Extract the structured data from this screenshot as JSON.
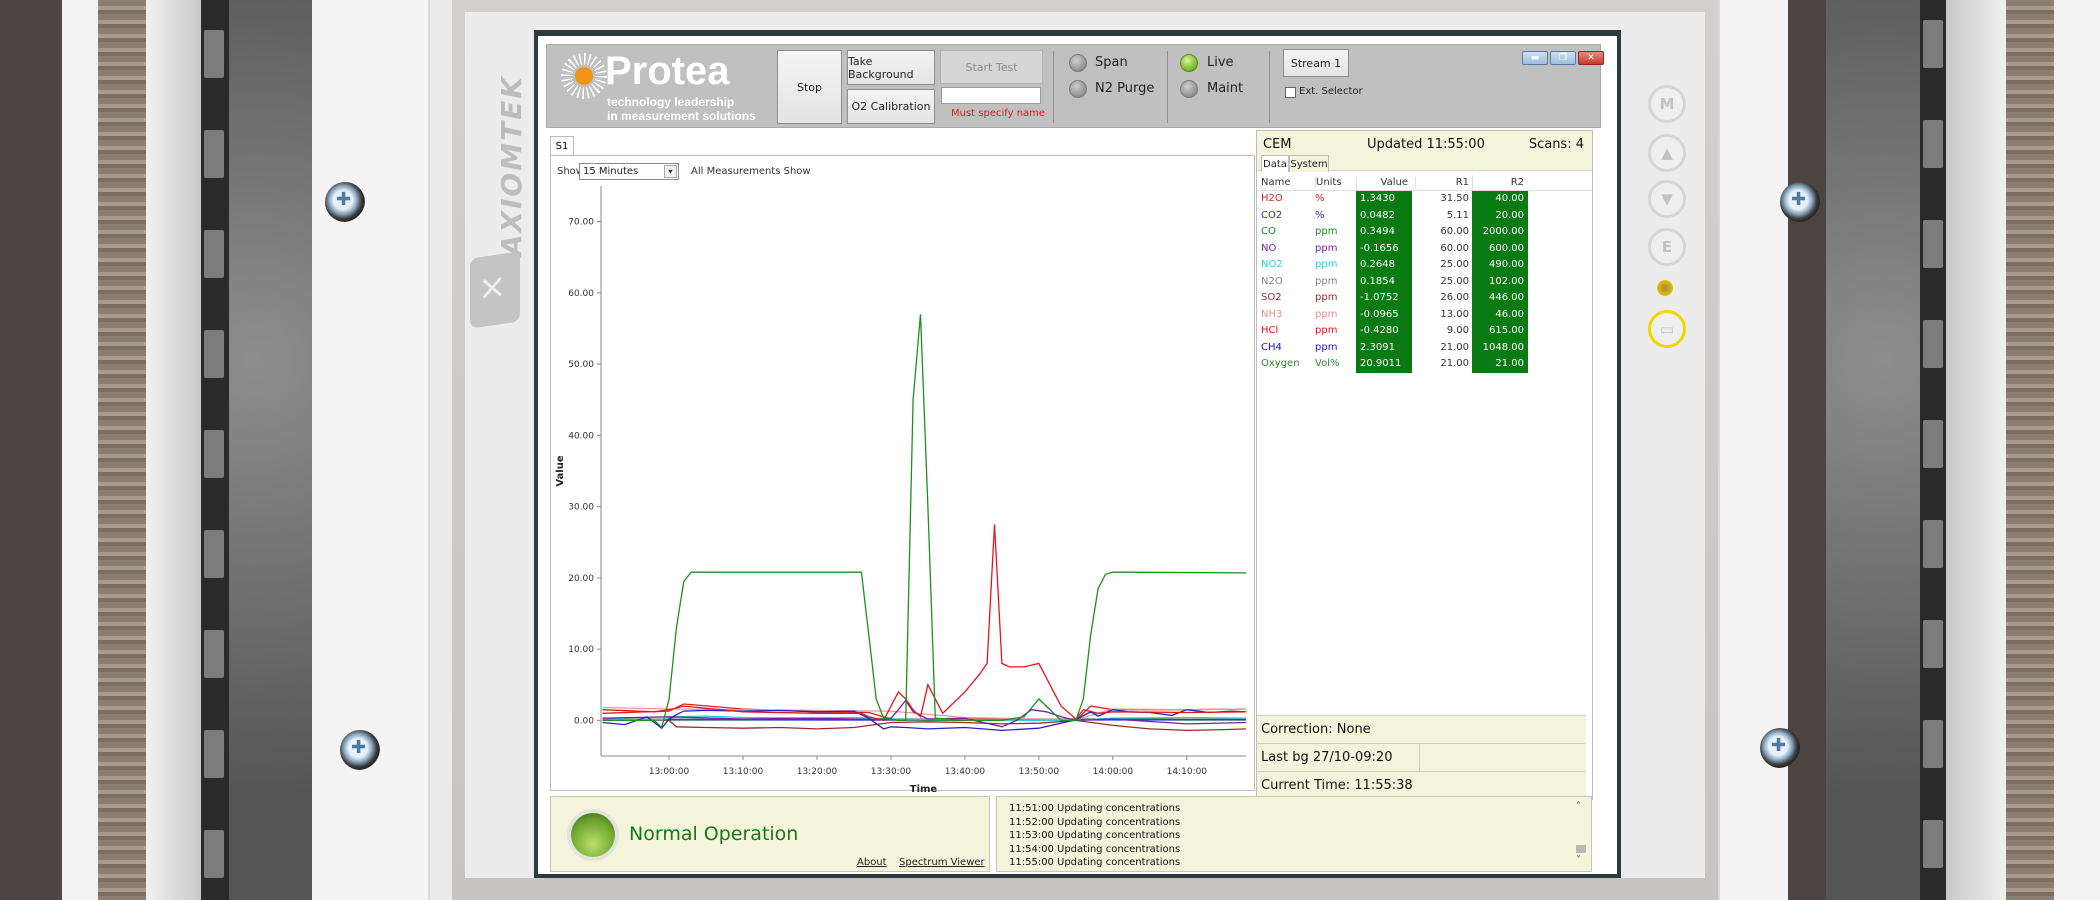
{
  "hardware": {
    "brand": "AXIOMTEK",
    "side_buttons": [
      {
        "name": "menu",
        "glyph": "M"
      },
      {
        "name": "up",
        "glyph": "▲"
      },
      {
        "name": "down",
        "glyph": "▼"
      },
      {
        "name": "enter",
        "glyph": "E"
      },
      {
        "name": "power-led",
        "glyph": ""
      },
      {
        "name": "screen",
        "glyph": "▭"
      }
    ]
  },
  "app": {
    "logo": {
      "name": "Protea",
      "tagline_1": "technology leadership",
      "tagline_2": "in measurement solutions",
      "sun_color": "#f39419"
    },
    "toolbar": {
      "stop": "Stop",
      "take_background": "Take Background",
      "start_test": "Start Test",
      "o2_calibration": "O2 Calibration",
      "test_name_value": "",
      "test_name_warning": "Must specify name",
      "modes": [
        {
          "label": "Span",
          "active": false
        },
        {
          "label": "N2 Purge",
          "active": false
        },
        {
          "label": "Live",
          "active": true
        },
        {
          "label": "Maint",
          "active": false
        }
      ],
      "stream_button": "Stream 1",
      "ext_selector_label": "Ext. Selector",
      "ext_selector_checked": false
    },
    "window_controls": {
      "minimize": "▬",
      "restore": "❐",
      "close": "✕"
    },
    "chart_panel": {
      "tab": "S1",
      "show_label": "Show",
      "show_value": "15 Minutes",
      "all_measurements": "All Measurements Show"
    },
    "cem": {
      "title": "CEM",
      "updated": "Updated 11:55:00",
      "scans": "Scans: 4",
      "tabs": [
        "Data",
        "System"
      ],
      "columns": [
        "Name",
        "Units",
        "Value",
        "R1",
        "R2"
      ],
      "rows": [
        {
          "name": "H2O",
          "units": "%",
          "value": "1.3430",
          "r1": "31.50",
          "r2": "40.00",
          "color": "#d9241c"
        },
        {
          "name": "CO2",
          "units": "%",
          "value": "0.0482",
          "r1": "5.11",
          "r2": "20.00",
          "color": "#2a2ab8"
        },
        {
          "name": "CO",
          "units": "ppm",
          "value": "0.3494",
          "r1": "60.00",
          "r2": "2000.00",
          "color": "#1d8a1d"
        },
        {
          "name": "NO",
          "units": "ppm",
          "value": "-0.1656",
          "r1": "60.00",
          "r2": "600.00",
          "color": "#7a1fa2"
        },
        {
          "name": "NO2",
          "units": "ppm",
          "value": "0.2648",
          "r1": "25.00",
          "r2": "490.00",
          "color": "#22d4dc"
        },
        {
          "name": "N2O",
          "units": "ppm",
          "value": "0.1854",
          "r1": "25.00",
          "r2": "102.00",
          "color": "#808080"
        },
        {
          "name": "SO2",
          "units": "ppm",
          "value": "-1.0752",
          "r1": "26.00",
          "r2": "446.00",
          "color": "#a02a2a"
        },
        {
          "name": "NH3",
          "units": "ppm",
          "value": "-0.0965",
          "r1": "13.00",
          "r2": "46.00",
          "color": "#e8908a"
        },
        {
          "name": "HCl",
          "units": "ppm",
          "value": "-0.4280",
          "r1": "9.00",
          "r2": "615.00",
          "color": "#e0141e"
        },
        {
          "name": "CH4",
          "units": "ppm",
          "value": "2.3091",
          "r1": "21.00",
          "r2": "1048.00",
          "color": "#1a1ad0"
        },
        {
          "name": "Oxygen",
          "units": "Vol%",
          "value": "20.9011",
          "r1": "21.00",
          "r2": "21.00",
          "color": "#2a8a2a"
        }
      ],
      "correction": "Correction: None",
      "last_bg": "Last bg 27/10-09:20",
      "current_time": "Current Time: 11:55:38"
    },
    "status": {
      "text": "Normal Operation",
      "color": "#6ea431",
      "links": [
        "About",
        "Spectrum Viewer"
      ]
    },
    "log": [
      {
        "time": "11:51:00",
        "msg": "Updating concentrations"
      },
      {
        "time": "11:52:00",
        "msg": "Updating concentrations"
      },
      {
        "time": "11:53:00",
        "msg": "Updating concentrations"
      },
      {
        "time": "11:54:00",
        "msg": "Updating concentrations"
      },
      {
        "time": "11:55:00",
        "msg": "Updating concentrations"
      }
    ]
  },
  "chart_data": {
    "type": "line",
    "title": "",
    "xlabel": "Time",
    "ylabel": "Value",
    "x_unit": "minutes after 13:00:00",
    "xlim": [
      -9.2,
      78
    ],
    "ylim": [
      -5,
      75
    ],
    "xticks": [
      0,
      10,
      20,
      30,
      40,
      50,
      60,
      70
    ],
    "xtick_labels": [
      "13:00:00",
      "13:10:00",
      "13:20:00",
      "13:30:00",
      "13:40:00",
      "13:50:00",
      "14:00:00",
      "14:10:00"
    ],
    "yticks": [
      0,
      10,
      20,
      30,
      40,
      50,
      60,
      70
    ],
    "ytick_labels": [
      "0.00",
      "10.00",
      "20.00",
      "30.00",
      "40.00",
      "50.00",
      "60.00",
      "70.00"
    ],
    "grid": false,
    "legend": "none",
    "series": [
      {
        "name": "Oxygen",
        "color": "#1f8f1f",
        "x": [
          -9,
          -2,
          -1,
          0,
          1,
          2,
          3,
          26,
          27,
          28,
          29,
          31,
          32,
          33,
          34,
          35,
          36,
          40,
          45,
          48,
          50,
          53,
          55,
          56,
          57,
          58,
          59,
          60,
          62,
          78
        ],
        "y": [
          0,
          0,
          -1,
          3,
          13,
          19.5,
          20.8,
          20.8,
          12,
          3,
          0.3,
          0,
          0,
          45,
          57,
          30,
          0.3,
          0,
          0,
          0.5,
          3,
          0,
          0,
          3,
          12,
          18.5,
          20.5,
          20.8,
          20.8,
          20.7
        ]
      },
      {
        "name": "HCl",
        "color": "#e8141c",
        "x": [
          -9,
          -2,
          0,
          2,
          10,
          20,
          26,
          27,
          29,
          30,
          31,
          32,
          33,
          34,
          35,
          37,
          40,
          42,
          43,
          44,
          45,
          46,
          48,
          50,
          52,
          53,
          55,
          56,
          58,
          60,
          70,
          78
        ],
        "y": [
          1.5,
          1.2,
          1.5,
          2,
          1.2,
          1.0,
          1.0,
          0.5,
          0,
          2,
          4,
          3,
          1.5,
          0.5,
          5,
          1,
          4,
          6.5,
          8,
          27.5,
          8,
          7.5,
          7.5,
          8,
          4,
          2,
          0.2,
          1.5,
          1.0,
          1.2,
          1.1,
          1.2
        ]
      },
      {
        "name": "CH4",
        "color": "#2222d0",
        "x": [
          -9,
          -6,
          -3,
          -1,
          0,
          1,
          2,
          5,
          10,
          15,
          20,
          25,
          27,
          29,
          30,
          32,
          35,
          40,
          45,
          50,
          55,
          57,
          58,
          60,
          62,
          65,
          68,
          70,
          73,
          76,
          78
        ],
        "y": [
          -0.3,
          -0.6,
          0.5,
          -1.1,
          0.2,
          0.8,
          1.3,
          1.4,
          1.3,
          1.4,
          1.2,
          1.3,
          0.3,
          -1.2,
          -0.9,
          -1.0,
          -1.2,
          -1.0,
          -1.4,
          -1.1,
          0.1,
          1.2,
          0.6,
          1.5,
          1.2,
          1.1,
          0.7,
          1.5,
          1.1,
          1.3,
          1.2
        ]
      },
      {
        "name": "NO",
        "color": "#7a1fa2",
        "x": [
          -9,
          0,
          10,
          20,
          28,
          30,
          31,
          32,
          33,
          35,
          40,
          45,
          47,
          49,
          51,
          53,
          55,
          60,
          70,
          78
        ],
        "y": [
          0.3,
          0.5,
          0.2,
          0.3,
          0.1,
          0.3,
          1.5,
          2.8,
          1.2,
          0.2,
          0.3,
          -0.9,
          0,
          1.5,
          1.2,
          0.5,
          0,
          0.2,
          -0.5,
          -0.3
        ]
      },
      {
        "name": "NO2",
        "color": "#22d0d8",
        "x": [
          -9,
          -1,
          1,
          5,
          10,
          20,
          25,
          30,
          40,
          50,
          55,
          60,
          70,
          78
        ],
        "y": [
          0.2,
          0.1,
          0.5,
          0.6,
          0.4,
          0.3,
          0.4,
          0.2,
          0.1,
          0.0,
          0.0,
          0.3,
          0.4,
          0.3
        ]
      },
      {
        "name": "SO2",
        "color": "#a02a2a",
        "x": [
          -9,
          0,
          1,
          5,
          10,
          15,
          20,
          25,
          30,
          35,
          40,
          45,
          50,
          55,
          60,
          65,
          70,
          75,
          78
        ],
        "y": [
          0.2,
          0.0,
          -0.9,
          -1.0,
          -1.1,
          -1.0,
          -1.2,
          -1.0,
          -0.3,
          -0.2,
          -0.3,
          -0.5,
          -0.4,
          0.0,
          -0.7,
          -1.2,
          -1.4,
          -1.3,
          -1.2
        ]
      },
      {
        "name": "NH3",
        "color": "#eb9a94",
        "x": [
          -9,
          0,
          10,
          20,
          30,
          40,
          50,
          55,
          60,
          70,
          78
        ],
        "y": [
          1.8,
          1.6,
          1.5,
          1.4,
          1.3,
          0.4,
          0.2,
          0.1,
          1.6,
          1.5,
          1.6
        ]
      },
      {
        "name": "H2O",
        "color": "#d9241c",
        "x": [
          -9,
          0,
          2,
          10,
          20,
          27,
          30,
          40,
          50,
          55,
          57,
          60,
          70,
          78
        ],
        "y": [
          1.0,
          1.3,
          2.3,
          1.6,
          1.2,
          1.1,
          0.2,
          0.2,
          0.1,
          0.0,
          2.0,
          1.5,
          1.5,
          1.6
        ]
      },
      {
        "name": "CO",
        "color": "#0f6f0f",
        "x": [
          -9,
          10,
          20,
          30,
          40,
          50,
          60,
          70,
          78
        ],
        "y": [
          0.1,
          0.1,
          0.2,
          0.1,
          0.0,
          0.1,
          0.2,
          0.1,
          0.1
        ]
      },
      {
        "name": "CO2",
        "color": "#3a3ac8",
        "x": [
          -9,
          10,
          30,
          50,
          78
        ],
        "y": [
          0.05,
          0.05,
          0.04,
          0.05,
          0.05
        ]
      },
      {
        "name": "N2O",
        "color": "#8a8a8a",
        "x": [
          -9,
          20,
          40,
          60,
          78
        ],
        "y": [
          0.2,
          0.2,
          0.18,
          0.19,
          0.19
        ]
      }
    ]
  }
}
